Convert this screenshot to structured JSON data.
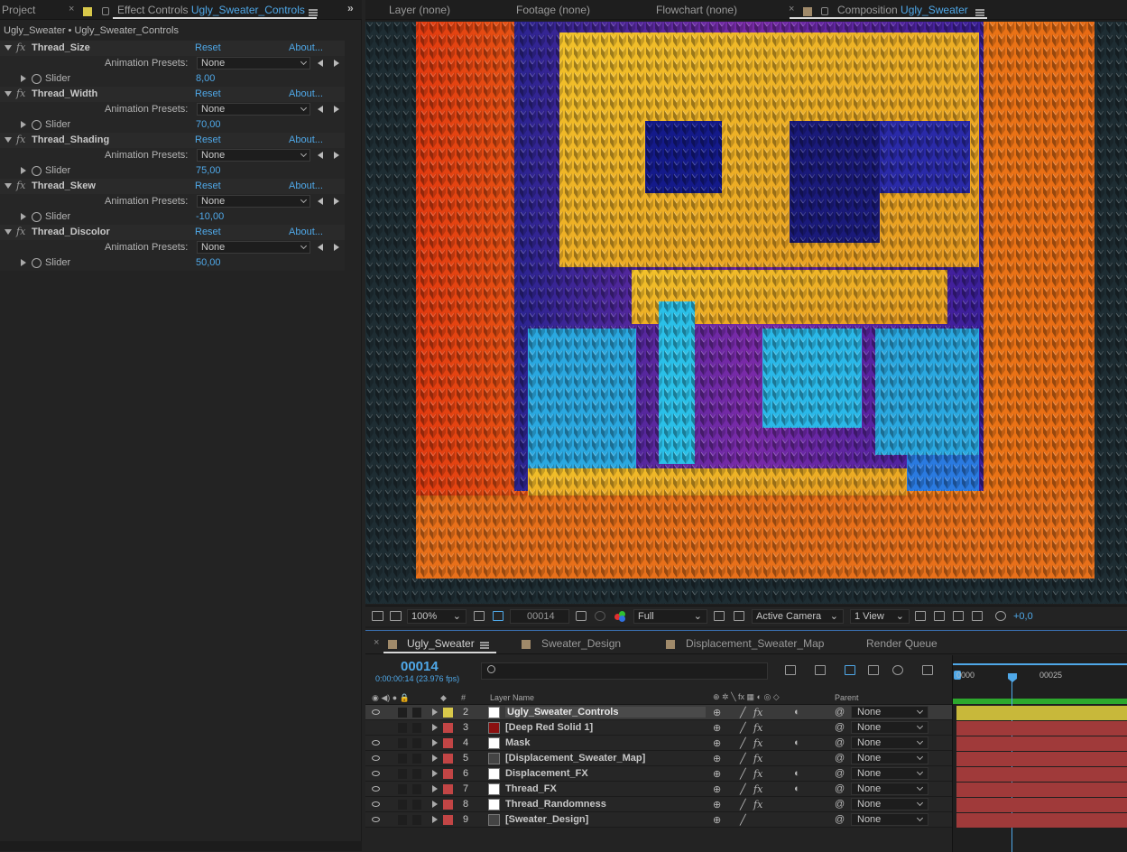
{
  "left_panel": {
    "project_tab": "Project",
    "effect_controls_tab": "Effect Controls",
    "effect_controls_layer": "Ugly_Sweater_Controls",
    "breadcrumb": "Ugly_Sweater • Ugly_Sweater_Controls",
    "reset_label": "Reset",
    "about_label": "About...",
    "presets_label": "Animation Presets:",
    "slider_label": "Slider",
    "effects": [
      {
        "name": "Thread_Size",
        "preset": "None",
        "value": "8,00"
      },
      {
        "name": "Thread_Width",
        "preset": "None",
        "value": "70,00"
      },
      {
        "name": "Thread_Shading",
        "preset": "None",
        "value": "75,00"
      },
      {
        "name": "Thread_Skew",
        "preset": "None",
        "value": "-10,00"
      },
      {
        "name": "Thread_Discolor",
        "preset": "None",
        "value": "50,00"
      }
    ]
  },
  "viewer": {
    "tabs": [
      "Layer (none)",
      "Footage (none)",
      "Flowchart (none)"
    ],
    "composition_tab": "Composition",
    "composition_name": "Ugly_Sweater",
    "zoom": "100%",
    "frame": "00014",
    "resolution": "Full",
    "camera": "Active Camera",
    "views": "1 View",
    "exposure": "+0,0"
  },
  "timeline": {
    "tabs": [
      "Ugly_Sweater",
      "Sweater_Design",
      "Displacement_Sweater_Map",
      "Render Queue"
    ],
    "current_frame": "00014",
    "timecode": "0:00:00:14 (23.976 fps)",
    "ruler_start": "0000",
    "ruler_mark": "00025",
    "col_layer_name": "Layer Name",
    "col_parent": "Parent",
    "col_hash": "#",
    "layers": [
      {
        "num": "2",
        "name": "Ugly_Sweater_Controls",
        "label_color": "#d8c84a",
        "thumb_color": "#ffffff",
        "parent": "None",
        "selected": true
      },
      {
        "num": "3",
        "name": "[Deep Red Solid 1]",
        "label_color": "#c24545",
        "thumb_color": "#8b1010",
        "parent": "None"
      },
      {
        "num": "4",
        "name": "Mask",
        "label_color": "#c24545",
        "thumb_color": "#ffffff",
        "parent": "None"
      },
      {
        "num": "5",
        "name": "[Displacement_Sweater_Map]",
        "label_color": "#c24545",
        "thumb_color": "#555555",
        "parent": "None"
      },
      {
        "num": "6",
        "name": "Displacement_FX",
        "label_color": "#c24545",
        "thumb_color": "#ffffff",
        "parent": "None"
      },
      {
        "num": "7",
        "name": "Thread_FX",
        "label_color": "#c24545",
        "thumb_color": "#ffffff",
        "parent": "None"
      },
      {
        "num": "8",
        "name": "Thread_Randomness",
        "label_color": "#c24545",
        "thumb_color": "#ffffff",
        "parent": "None"
      },
      {
        "num": "9",
        "name": "[Sweater_Design]",
        "label_color": "#c24545",
        "thumb_color": "#555555",
        "parent": "None"
      }
    ]
  },
  "colors": {
    "accent": "#4fa8e8",
    "yellow_label": "#d8c84a",
    "red_label": "#c24545"
  }
}
